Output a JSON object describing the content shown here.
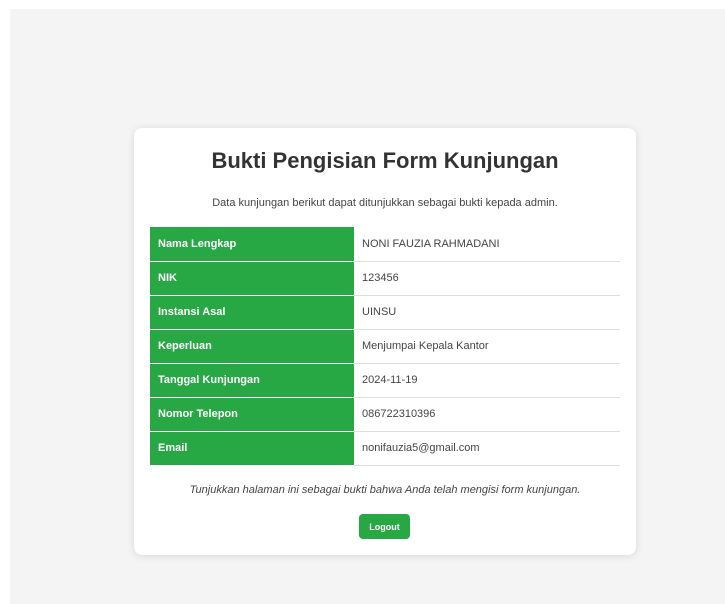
{
  "card": {
    "title": "Bukti Pengisian Form Kunjungan",
    "subtitle": "Data kunjungan berikut dapat ditunjukkan sebagai bukti kepada admin.",
    "rows": [
      {
        "label": "Nama Lengkap",
        "value": "NONI FAUZIA RAHMADANI"
      },
      {
        "label": "NIK",
        "value": "123456"
      },
      {
        "label": "Instansi Asal",
        "value": "UINSU"
      },
      {
        "label": "Keperluan",
        "value": "Menjumpai Kepala Kantor"
      },
      {
        "label": "Tanggal Kunjungan",
        "value": "2024-11-19"
      },
      {
        "label": "Nomor Telepon",
        "value": "086722310396"
      },
      {
        "label": "Email",
        "value": "nonifauzia5@gmail.com"
      }
    ],
    "note": "Tunjukkan halaman ini sebagai bukti bahwa Anda telah mengisi form kunjungan.",
    "logout_label": "Logout"
  },
  "colors": {
    "accent": "#28a745",
    "background": "#f4f4f4",
    "card": "#ffffff"
  }
}
